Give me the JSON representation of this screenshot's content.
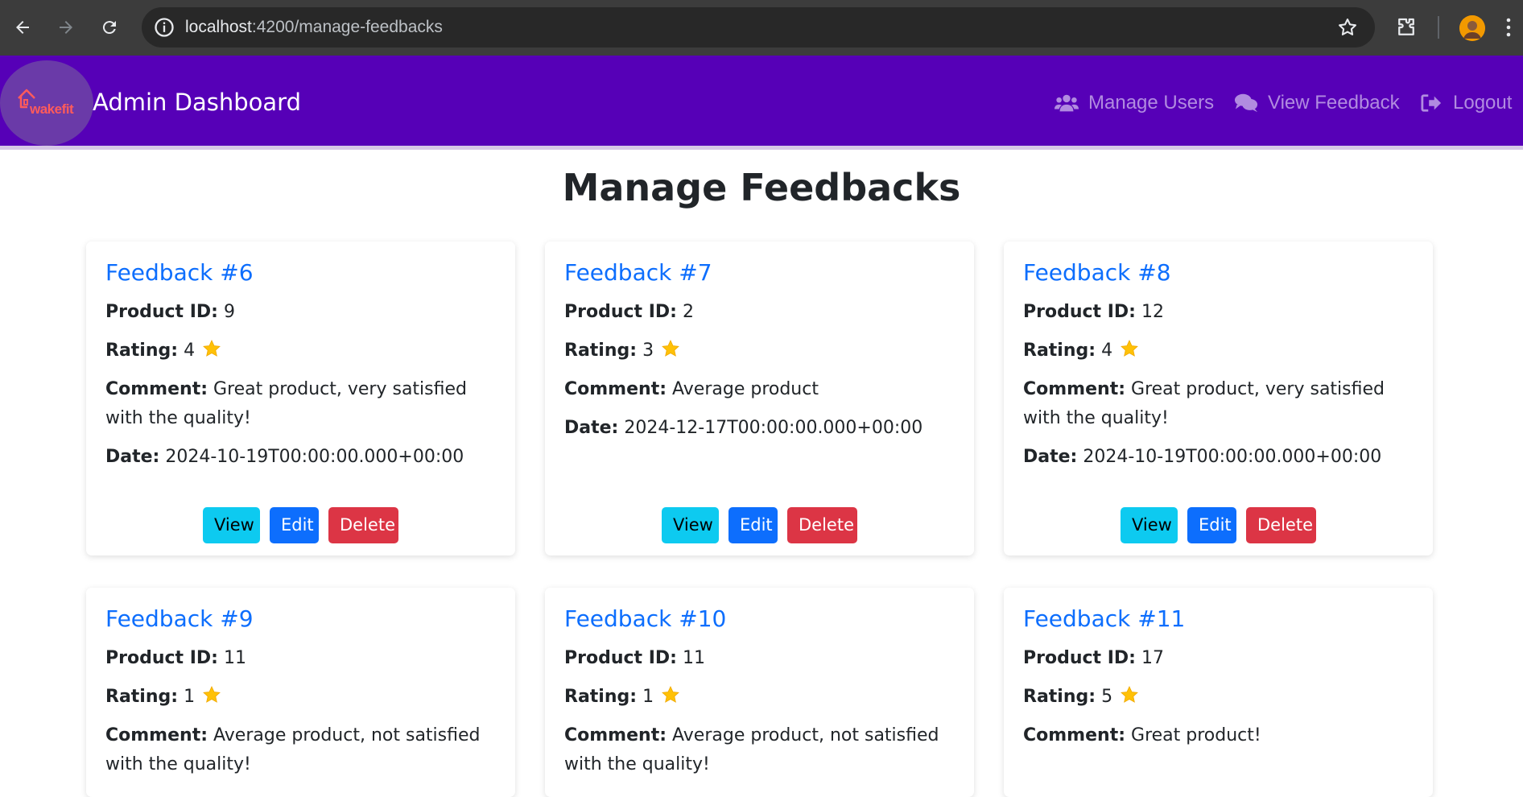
{
  "browser": {
    "url_host": "localhost",
    "url_path": ":4200/manage-feedbacks"
  },
  "navbar": {
    "logo_text": "wakefit",
    "brand": "Admin Dashboard",
    "links": [
      {
        "label": "Manage Users",
        "icon": "users-icon"
      },
      {
        "label": "View Feedback",
        "icon": "comments-icon"
      },
      {
        "label": "Logout",
        "icon": "logout-icon"
      }
    ]
  },
  "page": {
    "title": "Manage Feedbacks"
  },
  "labels": {
    "product_id": "Product ID:",
    "rating": "Rating:",
    "comment": "Comment:",
    "date": "Date:",
    "view": "View",
    "edit": "Edit",
    "delete": "Delete"
  },
  "colors": {
    "navbar": "#5600b7",
    "link": "#0d6efd",
    "view_btn": "#0dcaf0",
    "edit_btn": "#0d6efd",
    "delete_btn": "#dc3545",
    "star": "#ffc107"
  },
  "feedbacks": [
    {
      "title": "Feedback #6",
      "product_id": "9",
      "rating": "4",
      "comment": "Great product, very satisfied with the quality!",
      "date": "2024-10-19T00:00:00.000+00:00"
    },
    {
      "title": "Feedback #7",
      "product_id": "2",
      "rating": "3",
      "comment": "Average product",
      "date": "2024-12-17T00:00:00.000+00:00"
    },
    {
      "title": "Feedback #8",
      "product_id": "12",
      "rating": "4",
      "comment": "Great product, very satisfied with the quality!",
      "date": "2024-10-19T00:00:00.000+00:00"
    },
    {
      "title": "Feedback #9",
      "product_id": "11",
      "rating": "1",
      "comment": "Average product, not satisfied with the quality!",
      "date": ""
    },
    {
      "title": "Feedback #10",
      "product_id": "11",
      "rating": "1",
      "comment": "Average product, not satisfied with the quality!",
      "date": ""
    },
    {
      "title": "Feedback #11",
      "product_id": "17",
      "rating": "5",
      "comment": "Great product!",
      "date": ""
    }
  ]
}
